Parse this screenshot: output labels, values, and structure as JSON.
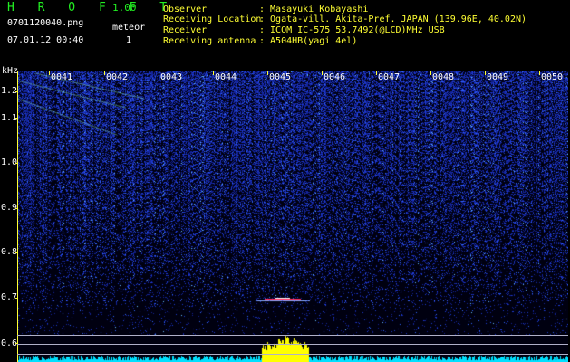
{
  "header": {
    "app_title": "H R O F F T",
    "app_version": "1.00",
    "filename": "0701120040.png",
    "meteor_label": "meteor",
    "meteor_count": "1",
    "datetime": "07.01.12 00:40"
  },
  "info": [
    {
      "label": "Observer",
      "value": ": Masayuki Kobayashi"
    },
    {
      "label": "Receiving Location",
      "value": ": Ogata-vill. Akita-Pref. JAPAN (139.96E, 40.02N)"
    },
    {
      "label": "Receiver",
      "value": ": ICOM IC-575 53.7492(@LCD)MHz USB"
    },
    {
      "label": "Receiving antenna",
      "value": ": A504HB(yagi 4el)"
    }
  ],
  "axis": {
    "unit": "kHz",
    "y_ticks": [
      "1.2",
      "1.1",
      "1.0",
      "0.9",
      "0.8",
      "0.7",
      "0.6"
    ],
    "x_ticks": [
      "0041",
      "0042",
      "0043",
      "0044",
      "0045",
      "0046",
      "0047",
      "0048",
      "0049",
      "0050"
    ]
  },
  "colors": {
    "header_green": "#22ee22",
    "info_yellow": "#ffff33",
    "axis_white": "#ffffff",
    "noise_blue": "#2244ff",
    "signal_yellow": "#ffff00",
    "meteor_red": "#ff3366",
    "baseline_cyan": "#00e0ff"
  }
}
